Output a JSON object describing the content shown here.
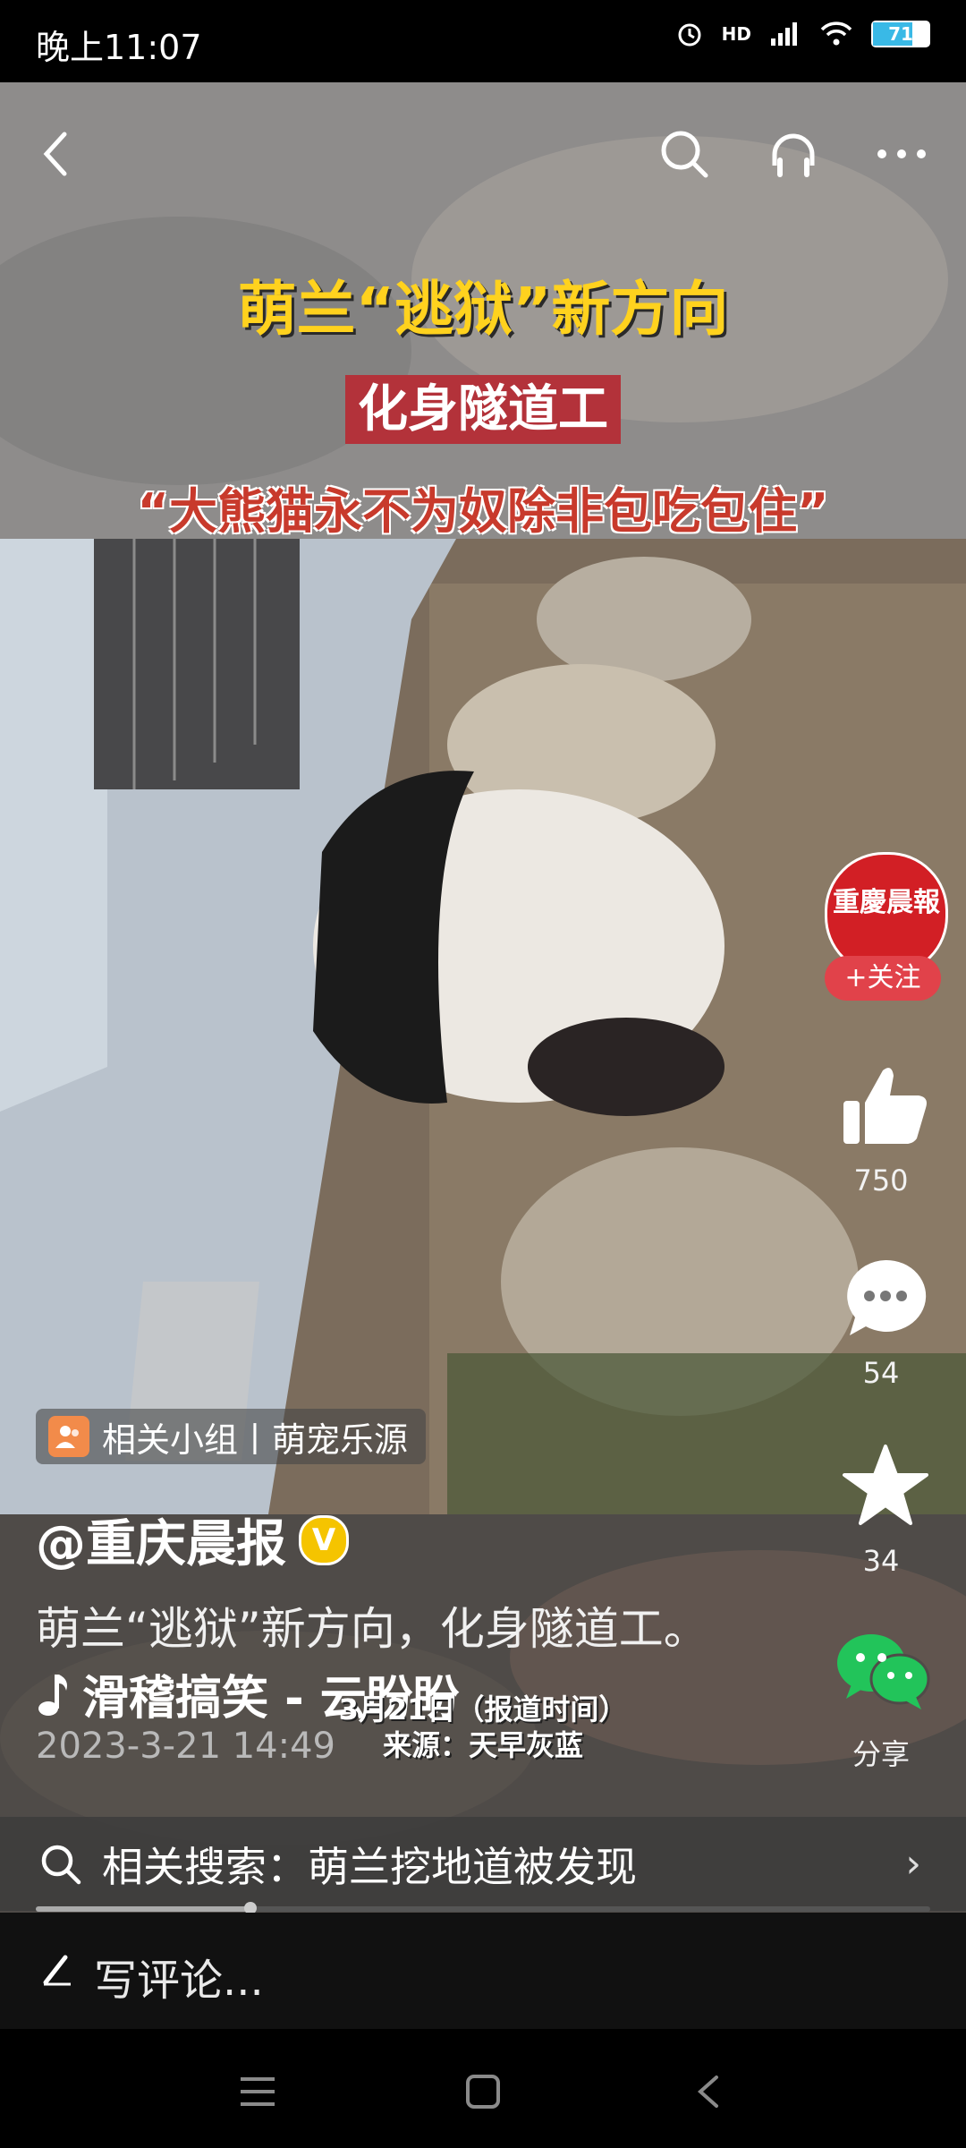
{
  "status_bar": {
    "time": "晚上11:07",
    "network": "HD",
    "battery": "71",
    "battery_level": 0.71
  },
  "video_overlay": {
    "headline": "萌兰“逃狱”新方向",
    "subhead": "化身隧道工",
    "quote": "“大熊猫永不为奴除非包吃包住”",
    "subtitle_line1": "3月21日（报道时间）",
    "subtitle_line2": "来源：天早灰蓝"
  },
  "top_nav": {
    "back_icon": "chevron-left-icon",
    "search_icon": "search-icon",
    "listen_icon": "headphones-icon",
    "more_icon": "more-icon"
  },
  "right_rail": {
    "avatar_text": "重慶晨報",
    "follow_label": "+关注",
    "likes": "750",
    "comments": "54",
    "favorites": "34",
    "share_label": "分享"
  },
  "post": {
    "group_tag": "相关小组丨萌宠乐源",
    "author": "@重庆晨报",
    "verified_mark": "V",
    "caption": "萌兰“逃狱”新方向，化身隧道工。",
    "music": "滑稽搞笑 - 云盼盼",
    "date": "2023-3-21 14:49"
  },
  "related_search": {
    "label": "相关搜索：萌兰挖地道被发现",
    "chevron": "›"
  },
  "comment_bar": {
    "placeholder": "写评论..."
  },
  "video_progress": 0.24,
  "colors": {
    "headline_yellow": "#ffd21e",
    "subhead_red": "#b3323a",
    "follow_red": "#e1424a",
    "wechat_green": "#22c45a",
    "verified_yellow": "#f5c400"
  }
}
